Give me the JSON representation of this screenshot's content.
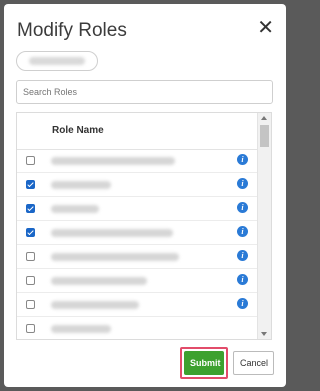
{
  "dialog": {
    "title": "Modify Roles",
    "close_icon": "close-icon",
    "search_placeholder": "Search Roles",
    "table": {
      "header": "Role Name",
      "rows": [
        {
          "checked": false
        },
        {
          "checked": true
        },
        {
          "checked": true
        },
        {
          "checked": true
        },
        {
          "checked": false
        },
        {
          "checked": false
        },
        {
          "checked": false
        },
        {
          "checked": false
        }
      ]
    },
    "buttons": {
      "submit": "Submit",
      "cancel": "Cancel"
    }
  },
  "colors": {
    "submit": "#3da12f",
    "highlight": "#e24c6a",
    "info": "#2a7ad6",
    "checkbox": "#1a66c7"
  }
}
